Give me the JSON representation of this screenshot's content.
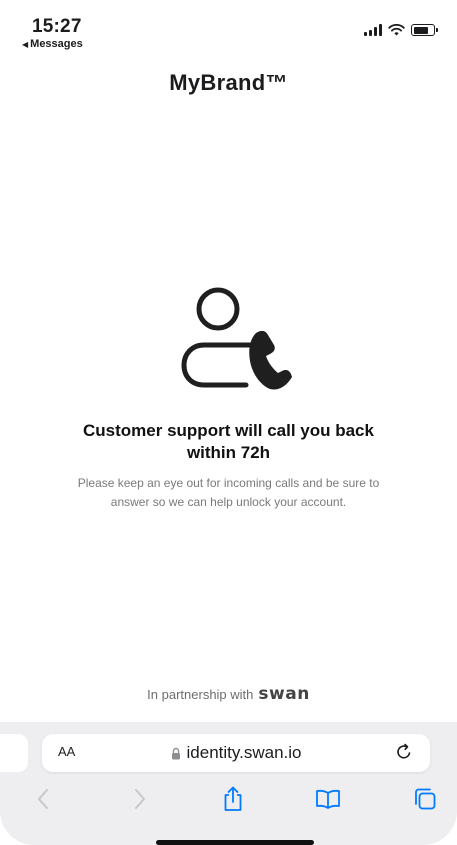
{
  "status_bar": {
    "time": "15:27",
    "back_app": "Messages"
  },
  "header": {
    "brand": "MyBrand™"
  },
  "main": {
    "icon": "person-phone-icon",
    "headline": "Customer support will call you back within 72h",
    "body": "Please keep an eye out for incoming calls and be sure to answer so we can help unlock your account."
  },
  "footer": {
    "partnership_prefix": "In partnership with",
    "partner_logo": "swan"
  },
  "browser": {
    "text_size_label": "AA",
    "url": "identity.swan.io",
    "toolbar": {
      "back": "chevron-left-icon",
      "forward": "chevron-right-icon",
      "share": "share-icon",
      "bookmarks": "book-icon",
      "tabs": "tabs-icon"
    }
  },
  "colors": {
    "text": "#1c1c1e",
    "muted": "#7a7a7a",
    "toolbar_bg": "#eeeef0",
    "accent": "#007aff",
    "disabled": "#c7c7cc"
  }
}
